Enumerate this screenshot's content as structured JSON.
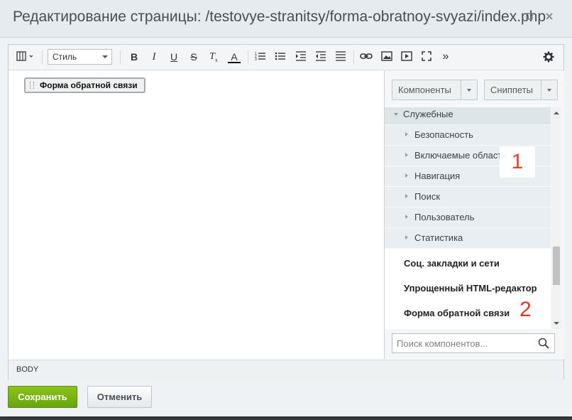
{
  "window": {
    "title": "Редактирование страницы: /testovye-stranitsy/forma-obratnoy-svyazi/index.php"
  },
  "toolbar": {
    "style_label": "Стиль",
    "buttons": [
      {
        "name": "template-icon"
      },
      {
        "name": "bold-icon",
        "glyph": "B"
      },
      {
        "name": "italic-icon",
        "glyph": "I"
      },
      {
        "name": "underline-icon",
        "glyph": "U"
      },
      {
        "name": "strikethrough-icon",
        "glyph": "S"
      },
      {
        "name": "clear-format-icon",
        "glyph": "T"
      },
      {
        "name": "font-color-icon",
        "glyph": "A"
      },
      {
        "name": "ordered-list-icon"
      },
      {
        "name": "unordered-list-icon"
      },
      {
        "name": "indent-icon"
      },
      {
        "name": "outdent-icon"
      },
      {
        "name": "align-icon"
      },
      {
        "name": "link-icon"
      },
      {
        "name": "image-icon"
      },
      {
        "name": "video-icon"
      },
      {
        "name": "fullscreen-icon"
      },
      {
        "name": "more-icon",
        "glyph": "»"
      },
      {
        "name": "settings-gear-icon"
      }
    ]
  },
  "content": {
    "component_chip": "Форма обратной связи"
  },
  "panel": {
    "components_label": "Компоненты",
    "snippets_label": "Сниппеты",
    "group": "Служебные",
    "subgroups": [
      "Безопасность",
      "Включаемые области",
      "Навигация",
      "Поиск",
      "Пользователь",
      "Статистика"
    ],
    "items": [
      "Соц. закладки и сети",
      "Упрощенный HTML-редактор",
      "Форма обратной связи"
    ],
    "search_placeholder": "Поиск компонентов..."
  },
  "annotations": {
    "marker1": "1",
    "marker2": "2"
  },
  "status": {
    "path": "BODY"
  },
  "footer": {
    "save_label": "Сохранить",
    "cancel_label": "Отменить"
  },
  "colors": {
    "save": "#78b212",
    "marker": "#e03a2e",
    "accent_group": "#dde5e9"
  }
}
